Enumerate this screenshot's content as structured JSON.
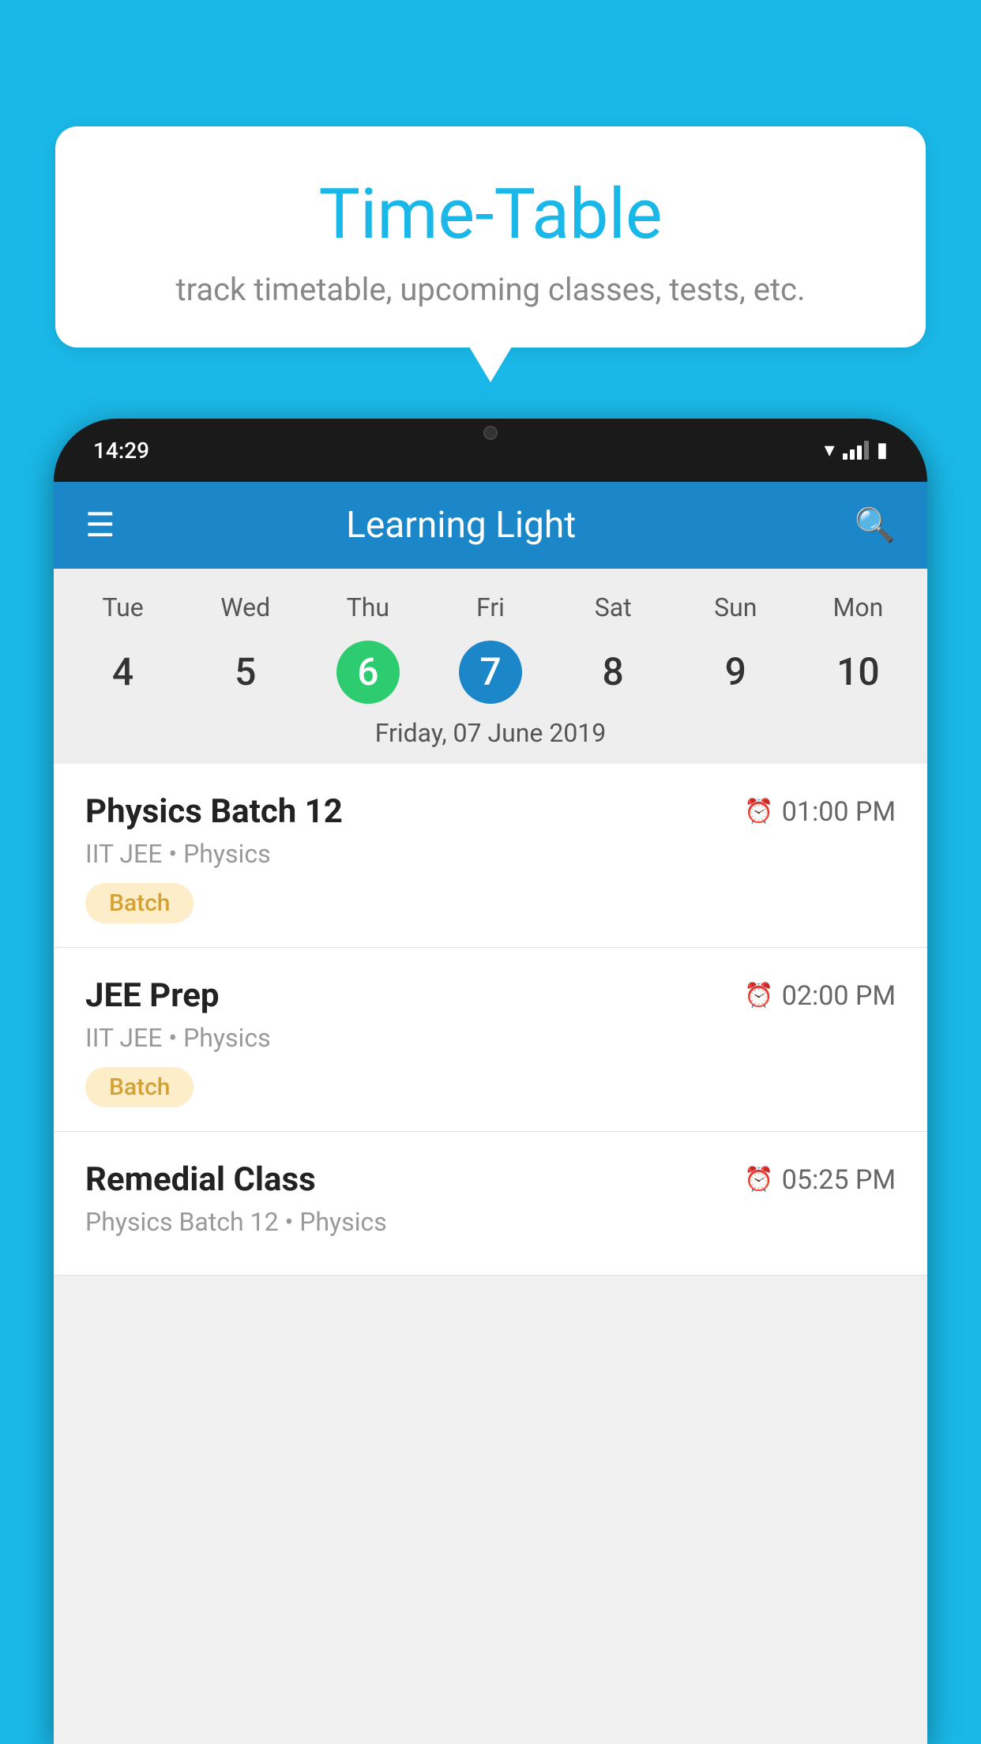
{
  "background_color": "#1ab8e8",
  "tooltip": {
    "title": "Time-Table",
    "subtitle": "track timetable, upcoming classes, tests, etc."
  },
  "phone": {
    "time": "14:29",
    "app_title": "Learning Light",
    "selected_date_label": "Friday, 07 June 2019",
    "days": [
      {
        "label": "Tue",
        "date": "4"
      },
      {
        "label": "Wed",
        "date": "5"
      },
      {
        "label": "Thu",
        "date": "6",
        "state": "today"
      },
      {
        "label": "Fri",
        "date": "7",
        "state": "selected"
      },
      {
        "label": "Sat",
        "date": "8"
      },
      {
        "label": "Sun",
        "date": "9"
      },
      {
        "label": "Mon",
        "date": "10"
      }
    ],
    "schedule": [
      {
        "title": "Physics Batch 12",
        "time": "01:00 PM",
        "subtitle": "IIT JEE • Physics",
        "tag": "Batch"
      },
      {
        "title": "JEE Prep",
        "time": "02:00 PM",
        "subtitle": "IIT JEE • Physics",
        "tag": "Batch"
      },
      {
        "title": "Remedial Class",
        "time": "05:25 PM",
        "subtitle": "Physics Batch 12 • Physics",
        "tag": ""
      }
    ]
  }
}
